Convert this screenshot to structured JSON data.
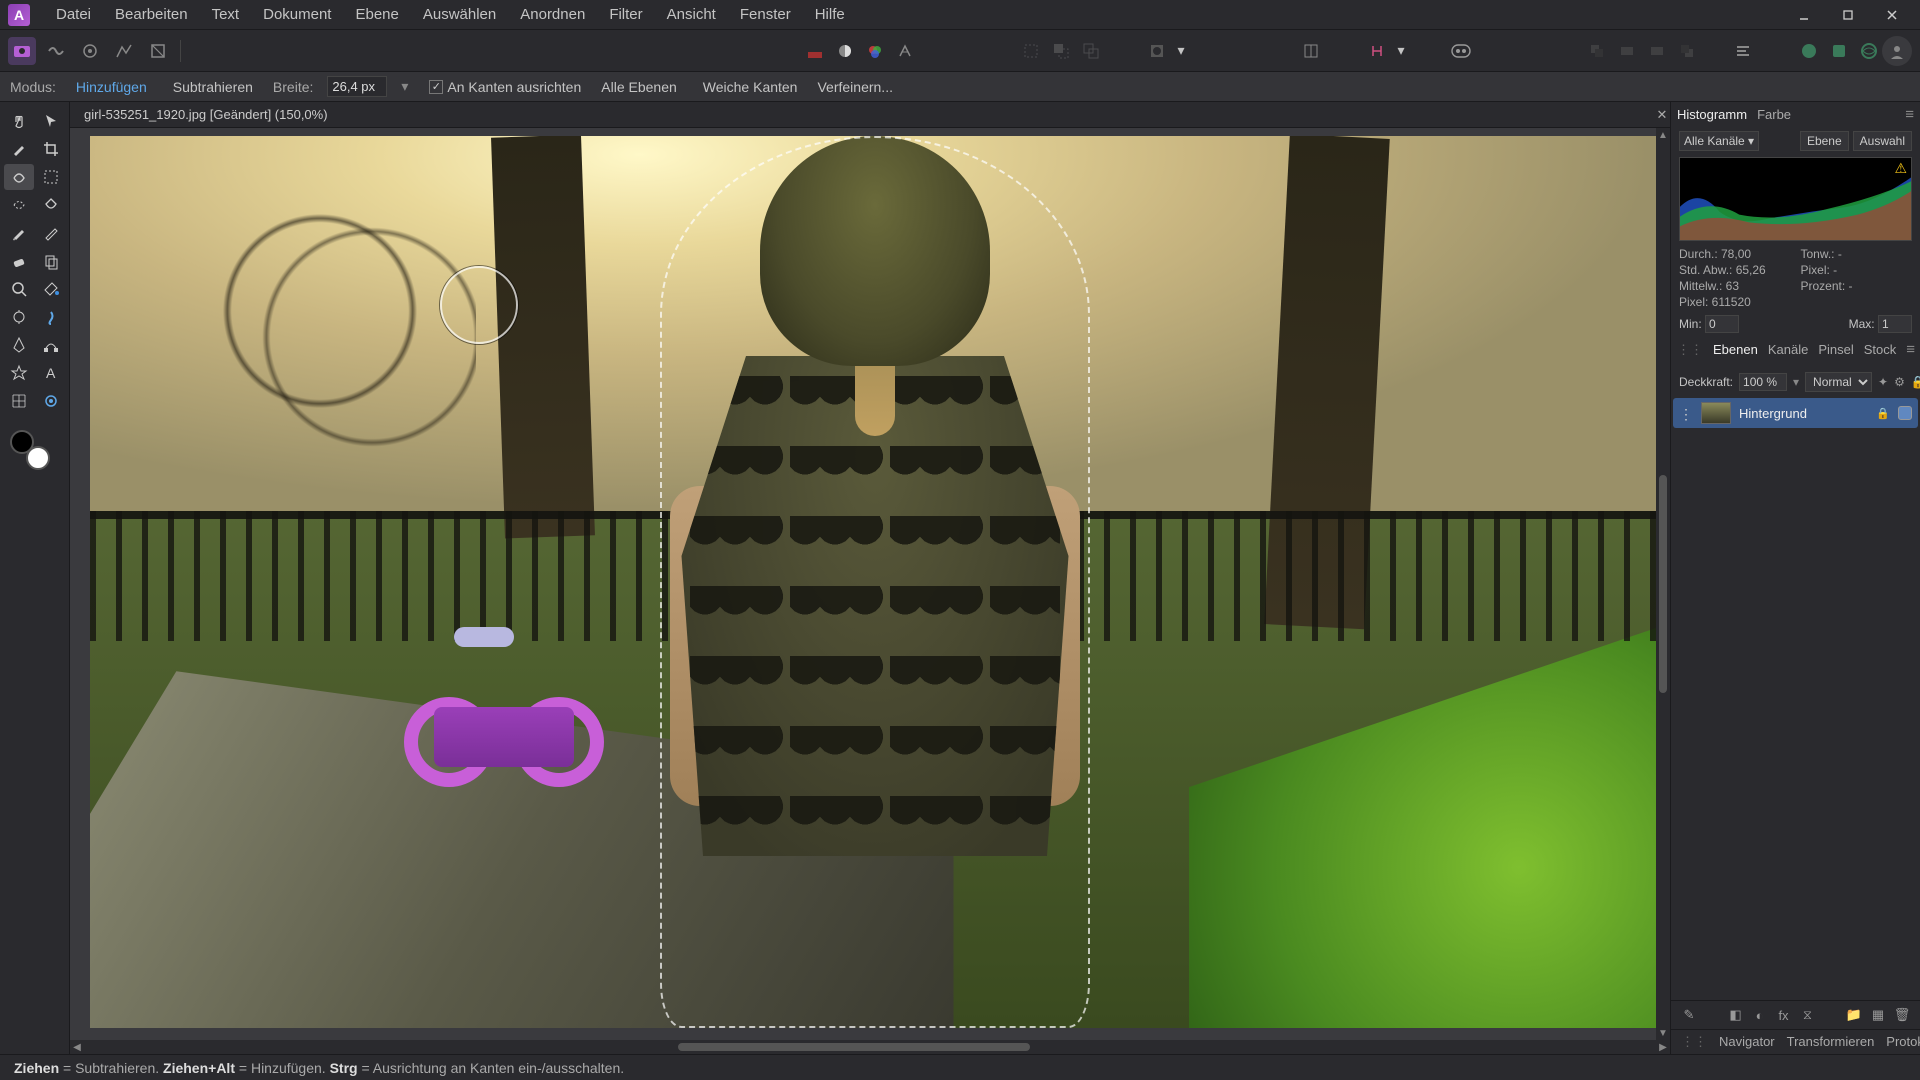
{
  "menu": [
    "Datei",
    "Bearbeiten",
    "Text",
    "Dokument",
    "Ebene",
    "Auswählen",
    "Anordnen",
    "Filter",
    "Ansicht",
    "Fenster",
    "Hilfe"
  ],
  "context_bar": {
    "mode_label": "Modus:",
    "mode_add": "Hinzufügen",
    "mode_sub": "Subtrahieren",
    "width_label": "Breite:",
    "width_value": "26,4 px",
    "snap_edges": "An Kanten ausrichten",
    "all_layers": "Alle Ebenen",
    "soft_edges": "Weiche Kanten",
    "refine": "Verfeinern..."
  },
  "document": {
    "tab_title": "girl-535251_1920.jpg [Geändert] (150,0%)"
  },
  "right_panel": {
    "histogram_tab": "Histogramm",
    "color_tab": "Farbe",
    "channel": "Alle Kanäle",
    "btn_layer": "Ebene",
    "btn_sel": "Auswahl",
    "stats": {
      "durch": "Durch.: 78,00",
      "std": "Std. Abw.: 65,26",
      "mittelw": "Mittelw.: 63",
      "pixel": "Pixel: 611520",
      "tonw": "Tonw.: -",
      "r_pixel": "Pixel: -",
      "prozent": "Prozent: -"
    },
    "min_label": "Min:",
    "min_val": "0",
    "max_label": "Max:",
    "max_val": "1",
    "layers_tab": "Ebenen",
    "channels_tab": "Kanäle",
    "brushes_tab": "Pinsel",
    "stock_tab": "Stock",
    "opacity_label": "Deckkraft:",
    "opacity_val": "100 %",
    "blend_mode": "Normal",
    "layer_name": "Hintergrund",
    "nav_tabs": [
      "Navigator",
      "Transformieren",
      "Protokoll"
    ]
  },
  "status": {
    "drag": "Ziehen",
    "drag_eq": " = Subtrahieren. ",
    "drag_alt": "Ziehen+Alt",
    "drag_alt_eq": " = Hinzufügen. ",
    "ctrl": "Strg",
    "ctrl_eq": " = Ausrichtung an Kanten ein-/ausschalten."
  }
}
